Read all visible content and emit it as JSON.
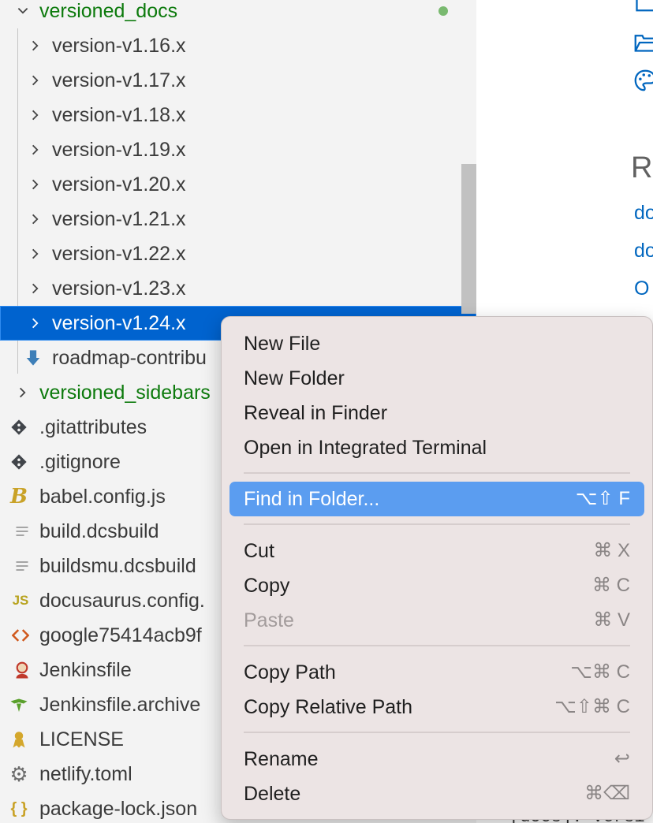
{
  "explorer": {
    "folder": {
      "name": "versioned_docs",
      "git_status": "modified"
    },
    "versions": [
      "version-v1.16.x",
      "version-v1.17.x",
      "version-v1.18.x",
      "version-v1.19.x",
      "version-v1.20.x",
      "version-v1.21.x",
      "version-v1.22.x",
      "version-v1.23.x",
      "version-v1.24.x"
    ],
    "selected": "version-v1.24.x",
    "roadmap_file": "roadmap-contribu",
    "sidebars_folder": "versioned_sidebars",
    "files": [
      {
        "name": ".gitattributes",
        "icon": "git-icon"
      },
      {
        "name": ".gitignore",
        "icon": "git-icon"
      },
      {
        "name": "babel.config.js",
        "icon": "babel-icon"
      },
      {
        "name": "build.dcsbuild",
        "icon": "text-file-icon"
      },
      {
        "name": "buildsmu.dcsbuild",
        "icon": "text-file-icon"
      },
      {
        "name": "docusaurus.config.",
        "icon": "js-icon"
      },
      {
        "name": "google75414acb9f",
        "icon": "html-icon"
      },
      {
        "name": "Jenkinsfile",
        "icon": "jenkins-icon"
      },
      {
        "name": "Jenkinsfile.archive",
        "icon": "jenkins-archive-icon"
      },
      {
        "name": "LICENSE",
        "icon": "license-icon"
      },
      {
        "name": "netlify.toml",
        "icon": "gear-icon"
      },
      {
        "name": "package-lock.json",
        "icon": "json-icon"
      }
    ]
  },
  "editor": {
    "heading": "Re",
    "links": [
      "do",
      "do",
      "O"
    ],
    "code_text": "[docs]: versi"
  },
  "context_menu": {
    "items": [
      {
        "label": "New File",
        "shortcut": ""
      },
      {
        "label": "New Folder",
        "shortcut": ""
      },
      {
        "label": "Reveal in Finder",
        "shortcut": ""
      },
      {
        "label": "Open in Integrated Terminal",
        "shortcut": ""
      },
      {
        "label": "Find in Folder...",
        "shortcut": "⌥⇧ F",
        "highlighted": true
      },
      {
        "label": "Cut",
        "shortcut": "⌘ X"
      },
      {
        "label": "Copy",
        "shortcut": "⌘ C"
      },
      {
        "label": "Paste",
        "shortcut": "⌘ V",
        "disabled": true
      },
      {
        "label": "Copy Path",
        "shortcut": "⌥⌘ C"
      },
      {
        "label": "Copy Relative Path",
        "shortcut": "⌥⇧⌘ C"
      },
      {
        "label": "Rename",
        "shortcut": "↩"
      },
      {
        "label": "Delete",
        "shortcut": "⌘⌫"
      }
    ]
  },
  "colors": {
    "selection": "#0063cf",
    "menu_highlight": "#5b9df0",
    "folder_green": "#0c7a0c",
    "git_dot": "#79b96f"
  }
}
